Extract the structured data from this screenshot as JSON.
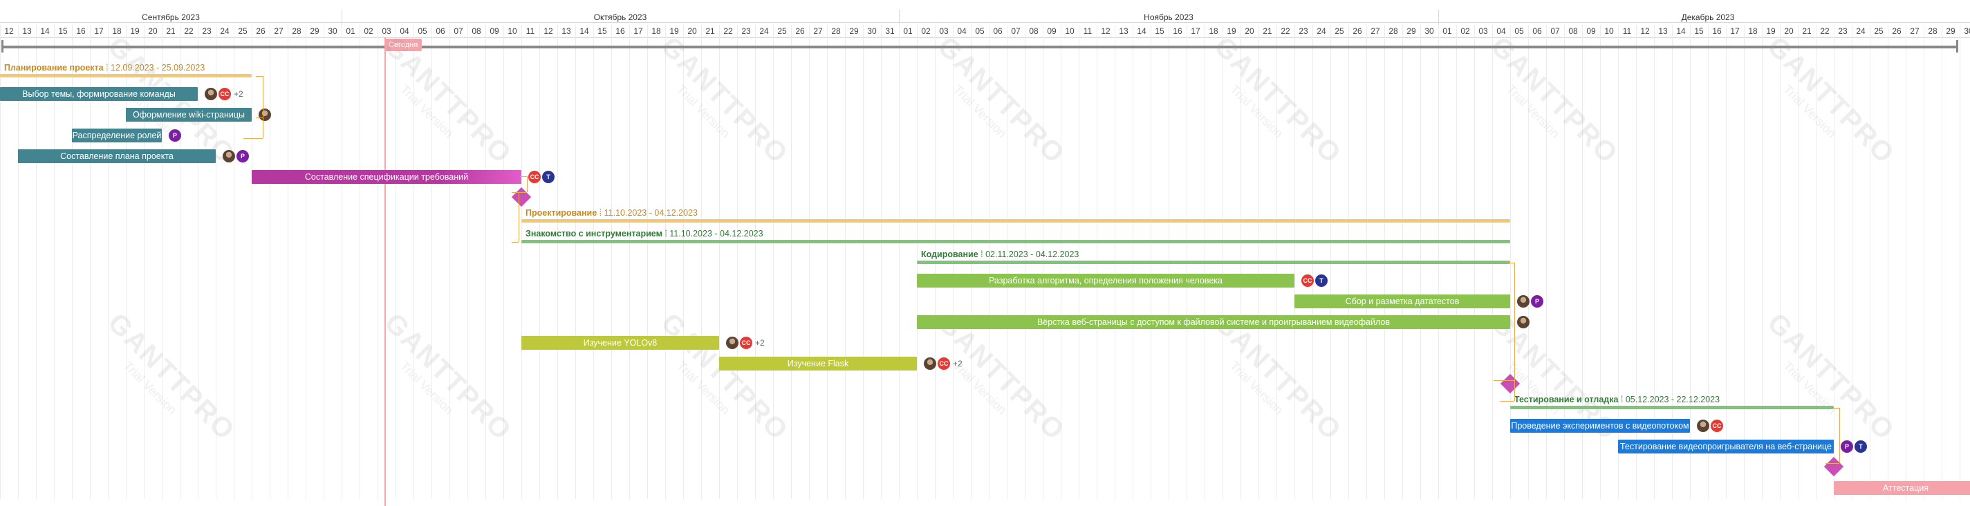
{
  "timeline": {
    "start": "2023-09-12",
    "end": "2023-12-30",
    "months": [
      {
        "label": "Сентябрь 2023",
        "start": "2023-09-12",
        "end": "2023-09-30"
      },
      {
        "label": "Октябрь 2023",
        "start": "2023-10-01",
        "end": "2023-10-31"
      },
      {
        "label": "Ноябрь 2023",
        "start": "2023-11-01",
        "end": "2023-11-30"
      },
      {
        "label": "Декабрь 2023",
        "start": "2023-12-01",
        "end": "2023-12-30"
      }
    ],
    "today_label": "Сегодня",
    "today_date": "2023-10-03"
  },
  "watermark": {
    "brand": "GANTTPRO",
    "note": "Trial Version"
  },
  "colors": {
    "teal": "#42848f",
    "magenta": "#b5389f",
    "milestone": "#c94fb6",
    "orange_group": "#f3c871",
    "green_group": "#7fc47a",
    "green_task": "#8cc34f",
    "olive_task": "#bdc93a",
    "blue_task": "#1e7ad6",
    "pink_task": "#f4a3ab",
    "connector": "#f0a84c"
  },
  "rows": [
    {
      "kind": "group",
      "name": "Планирование проекта",
      "dates": "12.09.2023 - 25.09.2023",
      "start": "2023-09-12",
      "end": "2023-09-25",
      "text_color": "#c98a1c",
      "line_color": "#f3c871"
    },
    {
      "kind": "task",
      "name": "Выбор темы, формирование команды",
      "start": "2023-09-12",
      "end": "2023-09-22",
      "color": "#42848f",
      "avatars": [
        "photo",
        "CC"
      ],
      "more": "+2"
    },
    {
      "kind": "task",
      "name": "Оформление wiki-страницы",
      "start": "2023-09-19",
      "end": "2023-09-25",
      "color": "#42848f",
      "avatars": [
        "photo"
      ],
      "more": ""
    },
    {
      "kind": "task",
      "name": "Распределение ролей",
      "start": "2023-09-16",
      "end": "2023-09-20",
      "color": "#42848f",
      "avatars": [
        "P"
      ],
      "more": ""
    },
    {
      "kind": "task",
      "name": "Составление плана проекта",
      "start": "2023-09-13",
      "end": "2023-09-23",
      "color": "#42848f",
      "avatars": [
        "photo",
        "P"
      ],
      "more": ""
    },
    {
      "kind": "task",
      "name": "Составление спецификации требований",
      "start": "2023-09-26",
      "end": "2023-10-10",
      "color": "#b5389f",
      "color2": "#e15dc9",
      "avatars": [
        "CC",
        "T"
      ],
      "more": ""
    },
    {
      "kind": "milestone",
      "name": "",
      "date": "2023-10-11"
    },
    {
      "kind": "group",
      "name": "Проектирование",
      "dates": "11.10.2023 - 04.12.2023",
      "start": "2023-10-11",
      "end": "2023-12-04",
      "text_color": "#c98a1c",
      "line_color": "#f3c871"
    },
    {
      "kind": "group",
      "name": "Знакомство с инструментарием",
      "dates": "11.10.2023 - 04.12.2023",
      "start": "2023-10-11",
      "end": "2023-12-04",
      "text_color": "#2e7d32",
      "line_color": "#7fc47a"
    },
    {
      "kind": "group",
      "name": "Кодирование",
      "dates": "02.11.2023 - 04.12.2023",
      "start": "2023-11-02",
      "end": "2023-12-04",
      "text_color": "#2e7d32",
      "line_color": "#7fc47a"
    },
    {
      "kind": "task",
      "name": "Разработка алгоритма, определения положения человека",
      "start": "2023-11-02",
      "end": "2023-11-22",
      "color": "#8cc34f",
      "avatars": [
        "CC",
        "T"
      ],
      "more": ""
    },
    {
      "kind": "task",
      "name": "Сбор и разметка дататестов",
      "start": "2023-11-23",
      "end": "2023-12-04",
      "color": "#8cc34f",
      "avatars": [
        "photo",
        "P"
      ],
      "more": ""
    },
    {
      "kind": "task",
      "name": "Вёрстка веб-страницы с доступом к файловой системе и проигрыванием видеофайлов",
      "start": "2023-11-02",
      "end": "2023-12-04",
      "color": "#8cc34f",
      "avatars": [
        "photo"
      ],
      "more": ""
    },
    {
      "kind": "task",
      "name": "Изучение YOLOv8",
      "start": "2023-10-11",
      "end": "2023-10-21",
      "color": "#bdc93a",
      "avatars": [
        "photo",
        "CC"
      ],
      "more": "+2"
    },
    {
      "kind": "task",
      "name": "Изучение Flask",
      "start": "2023-10-22",
      "end": "2023-11-01",
      "color": "#bdc93a",
      "avatars": [
        "photo",
        "CC"
      ],
      "more": "+2"
    },
    {
      "kind": "milestone",
      "name": "",
      "date": "2023-12-05"
    },
    {
      "kind": "group",
      "name": "Тестирование и отладка",
      "dates": "05.12.2023 - 22.12.2023",
      "start": "2023-12-05",
      "end": "2023-12-22",
      "text_color": "#2e7d32",
      "line_color": "#7fc47a"
    },
    {
      "kind": "task",
      "name": "Проведение экспериментов с видеопотоком",
      "start": "2023-12-05",
      "end": "2023-12-14",
      "color": "#1e7ad6",
      "avatars": [
        "photo",
        "CC"
      ],
      "more": ""
    },
    {
      "kind": "task",
      "name": "Тестирование видеопроигрывателя на веб-странице",
      "start": "2023-12-11",
      "end": "2023-12-22",
      "color": "#1e7ad6",
      "avatars": [
        "P",
        "T"
      ],
      "more": ""
    },
    {
      "kind": "milestone",
      "name": "",
      "date": "2023-12-23"
    },
    {
      "kind": "task",
      "name": "Аттестация",
      "start": "2023-12-23",
      "end": "2023-12-30",
      "color": "#f4a3ab",
      "avatars": [],
      "more": ""
    }
  ]
}
